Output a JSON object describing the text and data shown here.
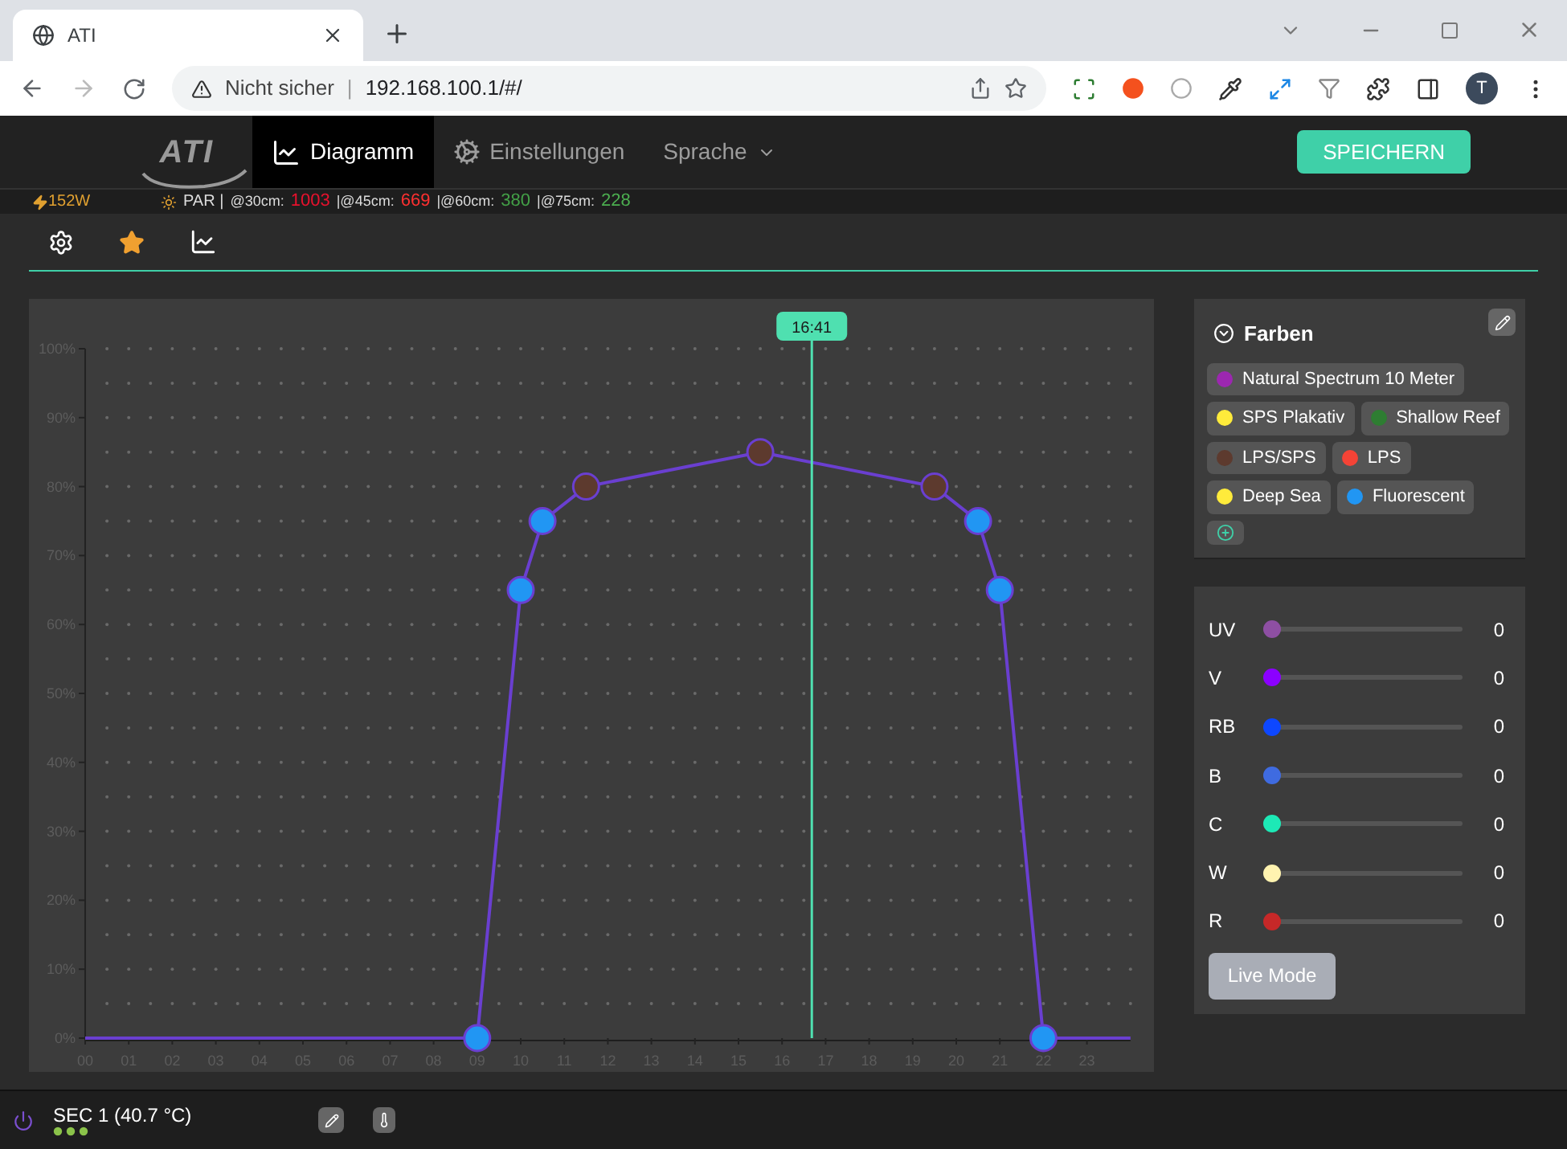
{
  "browser": {
    "tab_title": "ATI",
    "security": "Nicht sicher",
    "separator": "|",
    "url": "192.168.100.1/#/",
    "avatar": "T"
  },
  "nav": {
    "logo": "ATI",
    "items": [
      {
        "label": "Diagramm",
        "kind": "chart",
        "selected": true
      },
      {
        "label": "Einstellungen",
        "kind": "settings",
        "selected": false
      },
      {
        "label": "Sprache",
        "kind": "dropdown",
        "selected": false
      }
    ],
    "save_button": "SPEICHERN"
  },
  "info": {
    "power": "152W",
    "par_label": "PAR |",
    "readings": [
      {
        "label": "@30cm:",
        "value": "1003",
        "color": "#e8112d"
      },
      {
        "label": "|@45cm:",
        "value": "669",
        "color": "#ff3030"
      },
      {
        "label": "|@60cm:",
        "value": "380",
        "color": "#43a047"
      },
      {
        "label": "|@75cm:",
        "value": "228",
        "color": "#4caf50"
      }
    ]
  },
  "toolbar": [
    {
      "kind": "settings",
      "selected": false
    },
    {
      "kind": "star",
      "selected": true
    },
    {
      "kind": "chart",
      "selected": false
    }
  ],
  "diagram": {
    "current_time": "16:41",
    "points": [
      {
        "color": "#2196f3"
      },
      {
        "color": "#2196f3"
      },
      {
        "color": "#2196f3"
      },
      {
        "color": "#5d3a2e"
      },
      {
        "color": "#5d3a2e"
      },
      {
        "color": "#5d3a2e"
      },
      {
        "color": "#2196f3"
      },
      {
        "color": "#2196f3"
      },
      {
        "color": "#2196f3"
      }
    ],
    "chart_data": {
      "type": "line",
      "x": [
        0,
        9,
        10,
        10.5,
        11.5,
        15.5,
        19.5,
        20.5,
        21,
        22,
        24
      ],
      "series": [
        {
          "color": "#6a3fd0",
          "marker": true,
          "values": [
            0,
            0,
            65,
            75,
            80,
            85,
            80,
            75,
            65,
            0,
            0
          ]
        }
      ],
      "xlim": [
        0,
        24
      ],
      "ylim": [
        0,
        100
      ],
      "xticks": [
        {
          "value": 0,
          "label": "00"
        },
        {
          "value": 1,
          "label": "01"
        },
        {
          "value": 2,
          "label": "02"
        },
        {
          "value": 3,
          "label": "03"
        },
        {
          "value": 4,
          "label": "04"
        },
        {
          "value": 5,
          "label": "05"
        },
        {
          "value": 6,
          "label": "06"
        },
        {
          "value": 7,
          "label": "07"
        },
        {
          "value": 8,
          "label": "08"
        },
        {
          "value": 9,
          "label": "09"
        },
        {
          "value": 10,
          "label": "10"
        },
        {
          "value": 11,
          "label": "11"
        },
        {
          "value": 12,
          "label": "12"
        },
        {
          "value": 13,
          "label": "13"
        },
        {
          "value": 14,
          "label": "14"
        },
        {
          "value": 15,
          "label": "15"
        },
        {
          "value": 16,
          "label": "16"
        },
        {
          "value": 17,
          "label": "17"
        },
        {
          "value": 18,
          "label": "18"
        },
        {
          "value": 19,
          "label": "19"
        },
        {
          "value": 20,
          "label": "20"
        },
        {
          "value": 21,
          "label": "21"
        },
        {
          "value": 22,
          "label": "22"
        },
        {
          "value": 23,
          "label": "23"
        }
      ],
      "yticks": [
        {
          "value": 0,
          "label": "0%"
        },
        {
          "value": 10,
          "label": "10%"
        },
        {
          "value": 20,
          "label": "20%"
        },
        {
          "value": 30,
          "label": "30%"
        },
        {
          "value": 40,
          "label": "40%"
        },
        {
          "value": 50,
          "label": "50%"
        },
        {
          "value": 60,
          "label": "60%"
        },
        {
          "value": 70,
          "label": "70%"
        },
        {
          "value": 80,
          "label": "80%"
        },
        {
          "value": 90,
          "label": "90%"
        },
        {
          "value": 100,
          "label": "100%"
        }
      ],
      "ref_lines": [
        {
          "axis": "x",
          "value": 16.6833,
          "color": "#4fe0b0"
        }
      ]
    }
  },
  "colors_panel": {
    "title": "Farben",
    "presets": [
      {
        "label": "Natural Spectrum 10 Meter",
        "color": "#9c27b0"
      },
      {
        "label": "SPS Plakativ",
        "color": "#ffeb3b"
      },
      {
        "label": "Shallow Reef",
        "color": "#2e7d32"
      },
      {
        "label": "LPS/SPS",
        "color": "#5d3a2e"
      },
      {
        "label": "LPS",
        "color": "#f44336"
      },
      {
        "label": "Deep Sea",
        "color": "#ffeb3b"
      },
      {
        "label": "Fluorescent",
        "color": "#2196f3"
      }
    ]
  },
  "channels": [
    {
      "name": "UV",
      "level": 0,
      "reading": "0",
      "color": "#8e4fa3"
    },
    {
      "name": "V",
      "level": 0,
      "reading": "0",
      "color": "#8b00ff"
    },
    {
      "name": "RB",
      "level": 0,
      "reading": "0",
      "color": "#0d47ff"
    },
    {
      "name": "B",
      "level": 0,
      "reading": "0",
      "color": "#3f6be0"
    },
    {
      "name": "C",
      "level": 0,
      "reading": "0",
      "color": "#1de9b6"
    },
    {
      "name": "W",
      "level": 0,
      "reading": "0",
      "color": "#fff3b0"
    },
    {
      "name": "R",
      "level": 0,
      "reading": "0",
      "color": "#c62828"
    }
  ],
  "live_button": "Live Mode",
  "footer": {
    "device": "SEC 1 (40.7 °C)"
  }
}
